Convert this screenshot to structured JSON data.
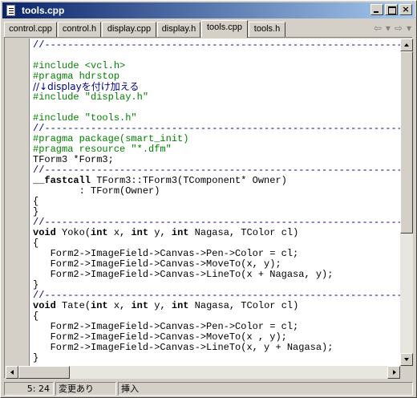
{
  "window": {
    "title": "tools.cpp"
  },
  "caption": {
    "minimize": "_",
    "maximize": "□",
    "close": "×"
  },
  "tabs": [
    {
      "label": "control.cpp",
      "active": false
    },
    {
      "label": "control.h",
      "active": false
    },
    {
      "label": "display.cpp",
      "active": false
    },
    {
      "label": "display.h",
      "active": false
    },
    {
      "label": "tools.cpp",
      "active": true
    },
    {
      "label": "tools.h",
      "active": false
    }
  ],
  "tab_nav": {
    "back": "⇦",
    "back_menu": "▾",
    "forward": "⇨",
    "forward_menu": "▾"
  },
  "editor": {
    "lines": [
      [
        {
          "t": "//---------------------------------------------------------------------------",
          "c": "comment"
        }
      ],
      [
        {
          "t": "",
          "c": ""
        }
      ],
      [
        {
          "t": "#include <vcl.h>",
          "c": "pp"
        }
      ],
      [
        {
          "t": "#pragma hdrstop",
          "c": "pp"
        }
      ],
      [
        {
          "t": "//↓displayを付け加える",
          "c": "jp"
        }
      ],
      [
        {
          "t": "#include \"display.h\"",
          "c": "pp"
        }
      ],
      [
        {
          "t": "",
          "c": ""
        }
      ],
      [
        {
          "t": "#include \"tools.h\"",
          "c": "pp"
        }
      ],
      [
        {
          "t": "//---------------------------------------------------------------------------",
          "c": "comment"
        }
      ],
      [
        {
          "t": "#pragma package(smart_init)",
          "c": "pp"
        }
      ],
      [
        {
          "t": "#pragma resource \"*.dfm\"",
          "c": "pp"
        }
      ],
      [
        {
          "t": "TForm3 *Form3;",
          "c": ""
        }
      ],
      [
        {
          "t": "//---------------------------------------------------------------------------",
          "c": "comment"
        }
      ],
      [
        {
          "t": "__fastcall",
          "c": "kw"
        },
        {
          "t": " TForm3::TForm3(TComponent* Owner)",
          "c": ""
        }
      ],
      [
        {
          "t": "        : TForm(Owner)",
          "c": ""
        }
      ],
      [
        {
          "t": "{",
          "c": ""
        }
      ],
      [
        {
          "t": "}",
          "c": ""
        }
      ],
      [
        {
          "t": "//---------------------------------------------------------------------------",
          "c": "comment"
        }
      ],
      [
        {
          "t": "void",
          "c": "kw"
        },
        {
          "t": " Yoko(",
          "c": ""
        },
        {
          "t": "int",
          "c": "kw"
        },
        {
          "t": " x, ",
          "c": ""
        },
        {
          "t": "int",
          "c": "kw"
        },
        {
          "t": " y, ",
          "c": ""
        },
        {
          "t": "int",
          "c": "kw"
        },
        {
          "t": " Nagasa, TColor cl)",
          "c": ""
        }
      ],
      [
        {
          "t": "{",
          "c": ""
        }
      ],
      [
        {
          "t": "   Form2->ImageField->Canvas->Pen->Color = cl;",
          "c": ""
        }
      ],
      [
        {
          "t": "   Form2->ImageField->Canvas->MoveTo(x, y);",
          "c": ""
        }
      ],
      [
        {
          "t": "   Form2->ImageField->Canvas->LineTo(x + Nagasa, y);",
          "c": ""
        }
      ],
      [
        {
          "t": "}",
          "c": ""
        }
      ],
      [
        {
          "t": "//---------------------------------------------------------------------------",
          "c": "comment"
        }
      ],
      [
        {
          "t": "void",
          "c": "kw"
        },
        {
          "t": " Tate(",
          "c": ""
        },
        {
          "t": "int",
          "c": "kw"
        },
        {
          "t": " x, ",
          "c": ""
        },
        {
          "t": "int",
          "c": "kw"
        },
        {
          "t": " y, ",
          "c": ""
        },
        {
          "t": "int",
          "c": "kw"
        },
        {
          "t": " Nagasa, TColor cl)",
          "c": ""
        }
      ],
      [
        {
          "t": "{",
          "c": ""
        }
      ],
      [
        {
          "t": "   Form2->ImageField->Canvas->Pen->Color = cl;",
          "c": ""
        }
      ],
      [
        {
          "t": "   Form2->ImageField->Canvas->MoveTo(x , y);",
          "c": ""
        }
      ],
      [
        {
          "t": "   Form2->ImageField->Canvas->LineTo(x, y + Nagasa);",
          "c": ""
        }
      ],
      [
        {
          "t": "}",
          "c": ""
        }
      ]
    ]
  },
  "status": {
    "position": "5: 24",
    "modified": "変更あり",
    "mode": "挿入"
  }
}
